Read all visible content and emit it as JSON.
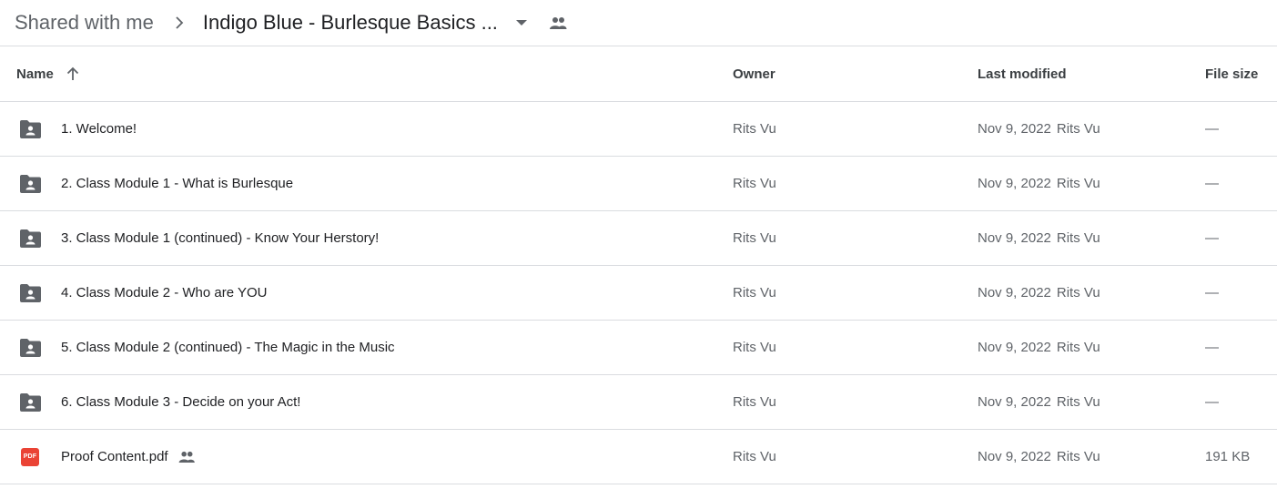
{
  "breadcrumb": {
    "root": "Shared with me",
    "separator_icon": "chevron-right-icon",
    "current": "Indigo Blue - Burlesque Basics ...",
    "dropdown_icon": "arrow-drop-down-icon",
    "shared_icon": "people-icon"
  },
  "table": {
    "columns": {
      "name": "Name",
      "owner": "Owner",
      "last_modified": "Last modified",
      "file_size": "File size"
    },
    "sort": {
      "column": "Name",
      "direction": "ascending",
      "icon": "arrow-upward-icon"
    },
    "rows": [
      {
        "type": "shared-folder",
        "icon": "shared-folder-icon",
        "name": "1. Welcome!",
        "owner": "Rits Vu",
        "modified_date": "Nov 9, 2022",
        "modified_by": "Rits Vu",
        "size": "—",
        "shared": false
      },
      {
        "type": "shared-folder",
        "icon": "shared-folder-icon",
        "name": "2. Class Module 1 - What is Burlesque",
        "owner": "Rits Vu",
        "modified_date": "Nov 9, 2022",
        "modified_by": "Rits Vu",
        "size": "—",
        "shared": false
      },
      {
        "type": "shared-folder",
        "icon": "shared-folder-icon",
        "name": "3. Class Module 1 (continued) - Know Your Herstory!",
        "owner": "Rits Vu",
        "modified_date": "Nov 9, 2022",
        "modified_by": "Rits Vu",
        "size": "—",
        "shared": false
      },
      {
        "type": "shared-folder",
        "icon": "shared-folder-icon",
        "name": "4. Class Module 2 - Who are YOU",
        "owner": "Rits Vu",
        "modified_date": "Nov 9, 2022",
        "modified_by": "Rits Vu",
        "size": "—",
        "shared": false
      },
      {
        "type": "shared-folder",
        "icon": "shared-folder-icon",
        "name": "5. Class Module 2 (continued) - The Magic in the Music",
        "owner": "Rits Vu",
        "modified_date": "Nov 9, 2022",
        "modified_by": "Rits Vu",
        "size": "—",
        "shared": false
      },
      {
        "type": "shared-folder",
        "icon": "shared-folder-icon",
        "name": "6. Class Module 3 - Decide on your Act!",
        "owner": "Rits Vu",
        "modified_date": "Nov 9, 2022",
        "modified_by": "Rits Vu",
        "size": "—",
        "shared": false
      },
      {
        "type": "pdf",
        "icon": "pdf-icon",
        "icon_label": "PDF",
        "name": "Proof Content.pdf",
        "owner": "Rits Vu",
        "modified_date": "Nov 9, 2022",
        "modified_by": "Rits Vu",
        "size": "191 KB",
        "shared": true
      }
    ]
  },
  "colors": {
    "icon_gray": "#5f6368",
    "pdf_red": "#ea4335",
    "divider": "#dadce0",
    "text_primary": "#202124",
    "text_secondary": "#5f6368"
  }
}
